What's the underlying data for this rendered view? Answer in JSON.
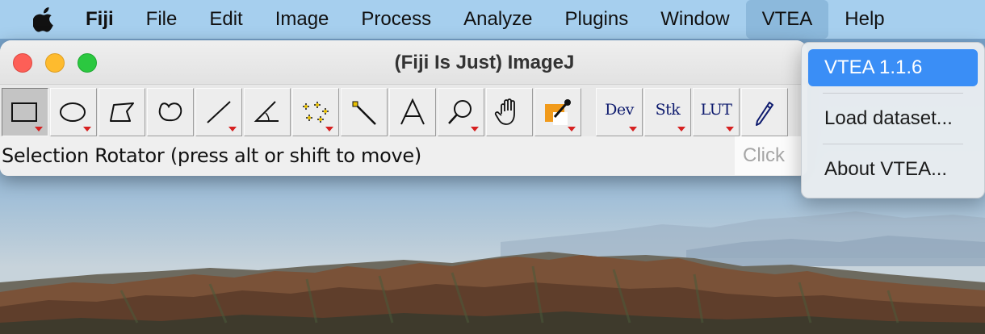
{
  "menubar": {
    "apple_icon": "apple-logo-icon",
    "app_name": "Fiji",
    "items": [
      "File",
      "Edit",
      "Image",
      "Process",
      "Analyze",
      "Plugins",
      "Window",
      "VTEA",
      "Help"
    ],
    "active_item": "VTEA"
  },
  "window": {
    "title": "(Fiji Is Just) ImageJ",
    "controls": [
      "close",
      "minimize",
      "zoom"
    ]
  },
  "toolbar": {
    "tools": [
      {
        "name": "rectangle-selection-icon",
        "selected": true
      },
      {
        "name": "oval-selection-icon"
      },
      {
        "name": "polygon-selection-icon"
      },
      {
        "name": "freehand-selection-icon"
      },
      {
        "name": "straight-line-icon"
      },
      {
        "name": "angle-tool-icon"
      },
      {
        "name": "multi-point-icon"
      },
      {
        "name": "wand-tool-icon"
      },
      {
        "name": "text-tool-icon"
      },
      {
        "name": "magnifying-glass-icon"
      },
      {
        "name": "hand-scroll-icon"
      },
      {
        "name": "color-picker-icon"
      }
    ],
    "dev_label": "Dev",
    "stk_label": "Stk",
    "lut_label": "LUT",
    "pencil_icon": "pencil-icon"
  },
  "status": {
    "text": "Selection Rotator (press alt or shift to move)",
    "search_placeholder": "Click"
  },
  "vtea_menu": {
    "items": [
      "VTEA 1.1.6",
      "Load dataset...",
      "About VTEA..."
    ],
    "highlight_color": "#3a8ef6"
  },
  "colors": {
    "menubar": "#a6cfee",
    "close": "#fd5f57",
    "minimize": "#febb2e",
    "zoom": "#2bc840",
    "tool_marker": "#d62020"
  }
}
